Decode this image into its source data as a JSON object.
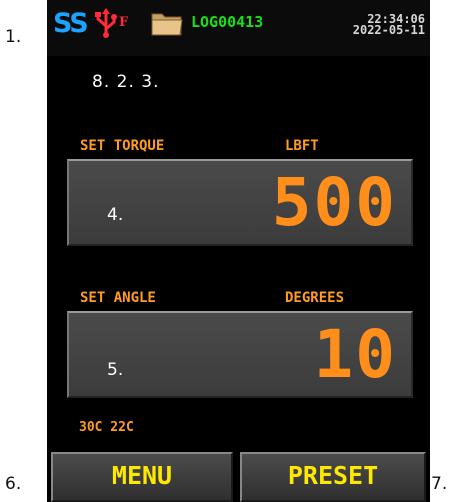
{
  "callouts": {
    "status_bar": "1.",
    "header_icons": "8. 2.  3.",
    "torque_field": "4.",
    "angle_field": "5.",
    "menu_key": "6.",
    "preset_key": "7."
  },
  "status_bar": {
    "logo": "SS",
    "usb_flag": "F",
    "log_file": "LOG00413",
    "time": "22:34:06",
    "date": "2022-05-11",
    "icons": [
      "ss-logo",
      "usb-icon",
      "folder-icon"
    ]
  },
  "torque": {
    "label": "SET TORQUE",
    "unit": "LBFT",
    "value": "500"
  },
  "angle": {
    "label": "SET ANGLE",
    "unit": "DEGREES",
    "value": "10"
  },
  "temperatures": "30C 22C",
  "softkeys": {
    "menu": "MENU",
    "preset": "PRESET"
  },
  "colors": {
    "screen_bg": "#000000",
    "label_orange": "#ff9c22",
    "value_orange": "#ff8f1a",
    "log_green": "#18e018",
    "softkey_yellow": "#ffe800",
    "logo_blue": "#1aa3ff",
    "usb_red": "#ff2b3a"
  }
}
